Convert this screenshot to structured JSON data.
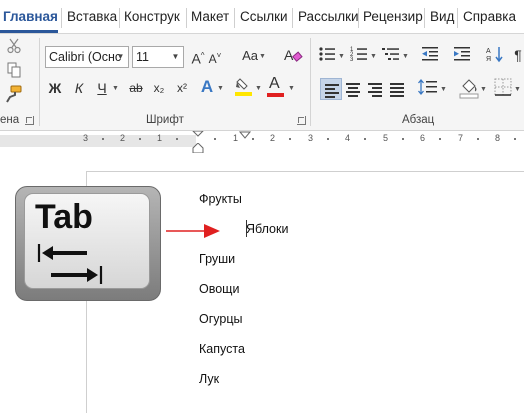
{
  "ribbon_tabs": [
    "Главная",
    "Вставка",
    "Конструк",
    "Макет",
    "Ссылки",
    "Рассылки",
    "Рецензир",
    "Вид",
    "Справка"
  ],
  "ribbon_groups": {
    "clipboard_label": "ена",
    "font_label": "Шрифт",
    "paragraph_label": "Абзац"
  },
  "font": {
    "family": "Calibri (Оснс",
    "size": "11",
    "grow": "A^",
    "shrink": "A˅",
    "case": "Aa",
    "bold": "Ж",
    "italic": "К",
    "underline": "Ч",
    "strikethrough": "ab",
    "subscript": "x₂",
    "superscript": "x²",
    "text_effects": "A",
    "font_color": "A"
  },
  "colors": {
    "accent": "#2b579a",
    "highlight": "#ffe600",
    "font_color": "#e02020",
    "arrow": "#e02020"
  },
  "ruler": {
    "labels": [
      "3",
      "2",
      "1",
      "1",
      "2",
      "3",
      "4",
      "5",
      "6",
      "7",
      "8"
    ]
  },
  "key": {
    "label": "Tab",
    "icon": "tab-arrows-icon"
  },
  "document": {
    "lines": [
      "Фрукты",
      "Яблоки",
      "Груши",
      "Овощи",
      "Огурцы",
      "Капуста",
      "Лук"
    ]
  }
}
